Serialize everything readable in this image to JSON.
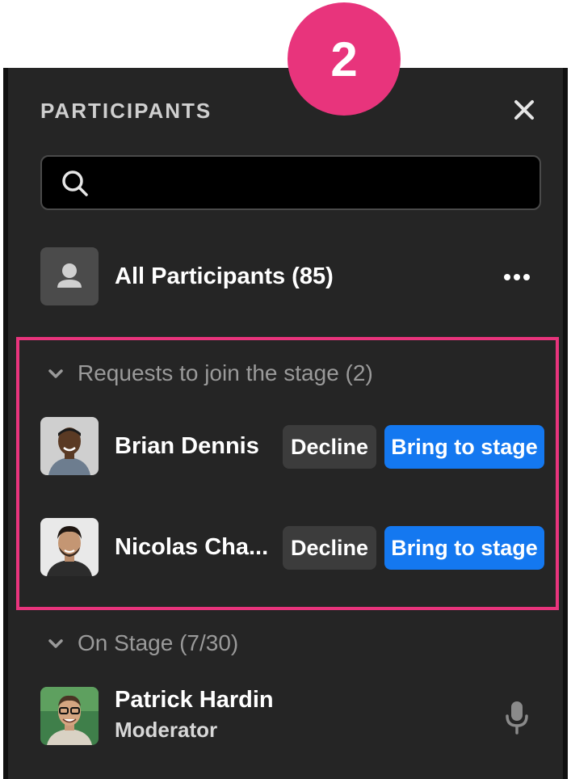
{
  "step_badge": "2",
  "panel": {
    "title": "PARTICIPANTS",
    "search": {
      "placeholder": "",
      "value": ""
    },
    "all_participants": {
      "label": "All Participants (85)"
    },
    "requests": {
      "header": "Requests to join the stage (2)",
      "items": [
        {
          "name": "Brian Dennis",
          "decline_label": "Decline",
          "bring_label": "Bring to stage"
        },
        {
          "name": "Nicolas Cha...",
          "decline_label": "Decline",
          "bring_label": "Bring to stage"
        }
      ]
    },
    "on_stage": {
      "header": "On Stage (7/30)",
      "items": [
        {
          "name": "Patrick Hardin",
          "role": "Moderator"
        }
      ]
    }
  },
  "colors": {
    "accent_pink": "#e8347c",
    "primary_blue": "#1478f0",
    "panel_bg": "#252525"
  }
}
